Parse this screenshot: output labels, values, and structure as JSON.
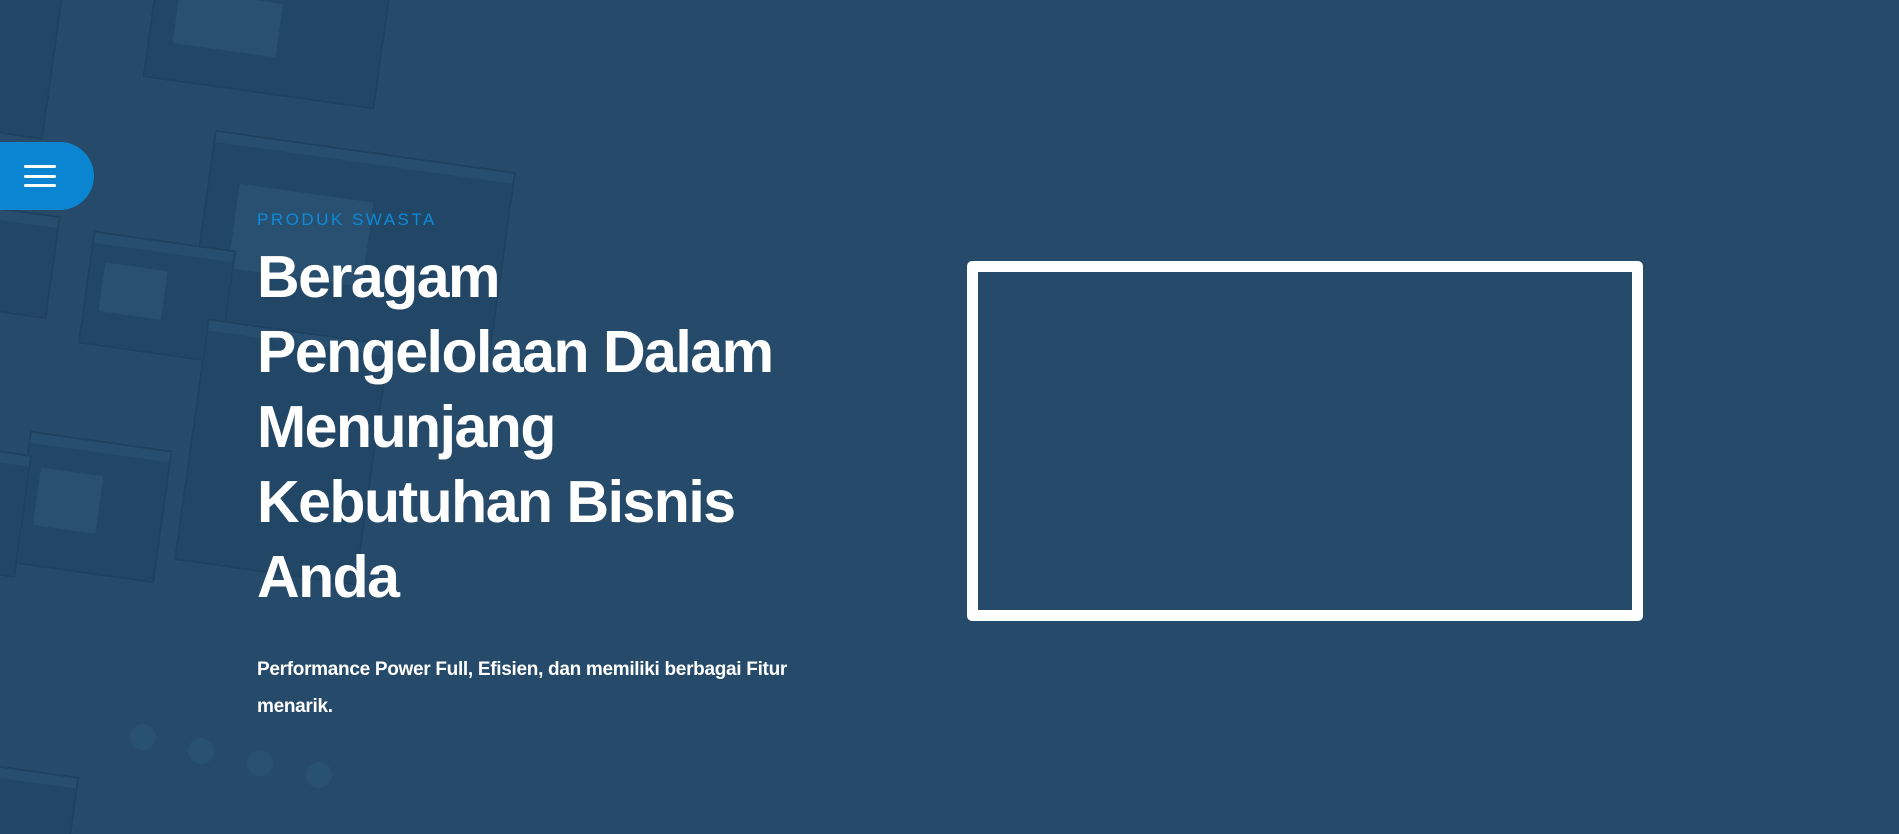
{
  "nav": {
    "menu_icon": "hamburger-menu-icon"
  },
  "hero": {
    "eyebrow": "PRODUK SWASTA",
    "headline": "Beragam Pengelolaan Dalam Menunjang Kebutuhan Bisnis Anda",
    "subtext": "Performance Power Full, Efisien, dan memiliki berbagai Fitur menarik."
  },
  "colors": {
    "background": "#264a69",
    "accent": "#0b84d1",
    "eyebrow": "#0b8bd8",
    "text": "#ffffff",
    "frame": "#ffffff"
  }
}
